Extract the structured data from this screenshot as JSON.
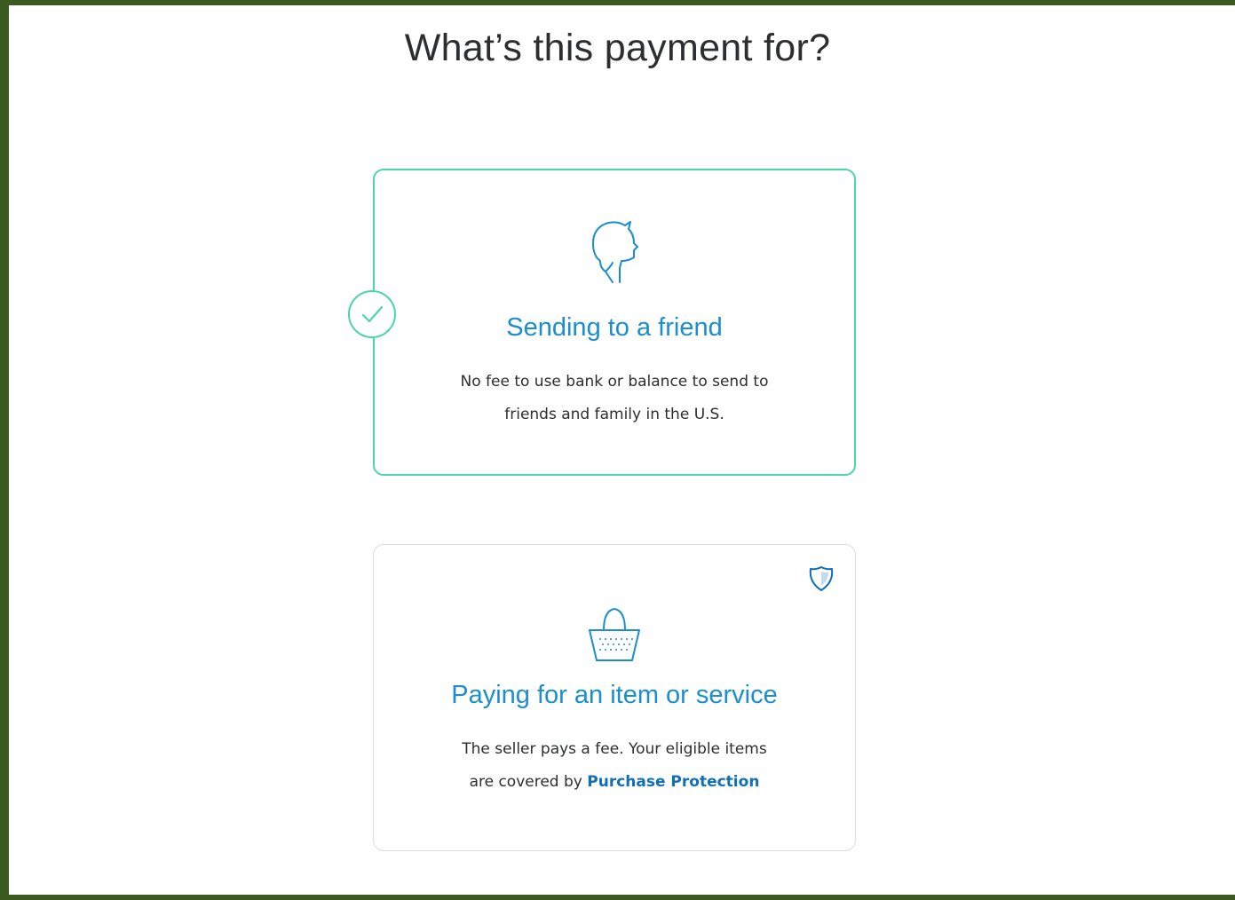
{
  "page": {
    "title": "What’s this payment for?"
  },
  "options": [
    {
      "title": "Sending to a friend",
      "desc_line1": "No fee to use bank or balance to send to",
      "desc_line2": "friends and family in the U.S.",
      "icon": "person-profile-icon",
      "selected": true
    },
    {
      "title": "Paying for an item or service",
      "desc_line1": "The seller pays a fee. Your eligible items",
      "desc_line2_prefix": "are covered by",
      "link_text": "Purchase Protection",
      "icon": "basket-icon",
      "badge_icon": "shield-icon",
      "selected": false
    }
  ],
  "colors": {
    "frame": "#3b5a20",
    "selected_border": "#4ad6a8",
    "accent_blue": "#1a8ecf",
    "link_blue": "#0f6fb8",
    "text": "#2c2e2f"
  }
}
